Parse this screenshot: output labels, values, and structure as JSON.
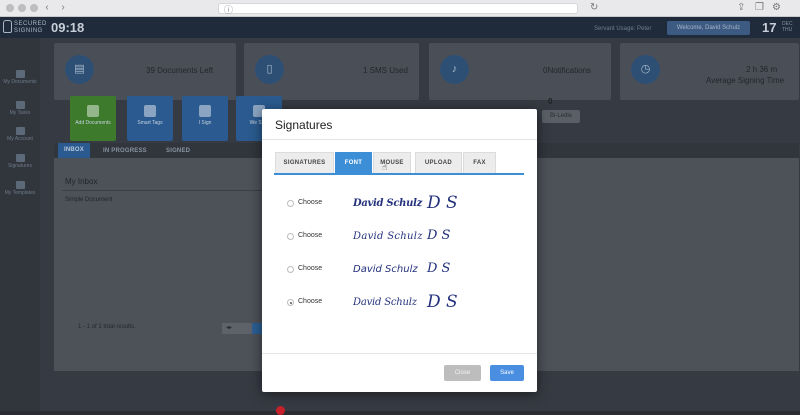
{
  "browser": {
    "url_icon": "info-icon"
  },
  "header": {
    "logo_text": "SECURED SIGNING",
    "time": "09:18",
    "user_name": "Servant Usage: Peter",
    "welcome_button": "Welcome, David Schulz",
    "date_day": "17",
    "date_month": "DEC",
    "date_weekday": "THU"
  },
  "sidebar": {
    "items": [
      {
        "label": "My Documents",
        "icon": "document-icon"
      },
      {
        "label": "My Tasks",
        "icon": "people-icon"
      },
      {
        "label": "My Account",
        "icon": "gear-icon"
      },
      {
        "label": "Signatures",
        "icon": "pen-icon"
      },
      {
        "label": "My Templates",
        "icon": "mail-icon"
      }
    ]
  },
  "stats": [
    {
      "value": "39 Documents Left",
      "icon": "document-icon"
    },
    {
      "value": "1 SMS Used",
      "icon": "phone-icon"
    },
    {
      "value": "0Notifications",
      "icon": "bell-icon"
    },
    {
      "value": "2 h 36 m",
      "sub": "Average Signing Time",
      "icon": "clock-icon"
    }
  ],
  "actions": [
    {
      "label": "Add Documents",
      "color": "#3d7a2c"
    },
    {
      "label": "Smart Tags",
      "color": "#2a5a8f"
    },
    {
      "label": "I Sign",
      "color": "#2a5a8f"
    },
    {
      "label": "We Sign",
      "color": "#2a5a8f"
    }
  ],
  "main": {
    "dim_number": "0",
    "edit_pill": "Bi-Ledle",
    "tabs": [
      "INBOX",
      "IN PROGRESS",
      "SIGNED"
    ],
    "inbox_title": "My Inbox",
    "inbox_row": "Simple Document",
    "footer": "1 - 1 of 1 total results."
  },
  "modal": {
    "title": "Signatures",
    "tabs": [
      "SIGNATURES",
      "FONT",
      "MOUSE",
      "UPLOAD",
      "FAX"
    ],
    "active_tab": "FONT",
    "options": [
      {
        "label": "Choose",
        "name": "David Schulz",
        "initials": "D S",
        "selected": false
      },
      {
        "label": "Choose",
        "name": "David Schulz",
        "initials": "D S",
        "selected": false
      },
      {
        "label": "Choose",
        "name": "David Schulz",
        "initials": "D S",
        "selected": false
      },
      {
        "label": "Choose",
        "name": "David Schulz",
        "initials": "D S",
        "selected": true
      }
    ],
    "close_label": "Close",
    "save_label": "Save"
  },
  "colors": {
    "accent": "#3c8ed7",
    "save": "#4a8ee2",
    "signature_ink": "#24327d"
  }
}
